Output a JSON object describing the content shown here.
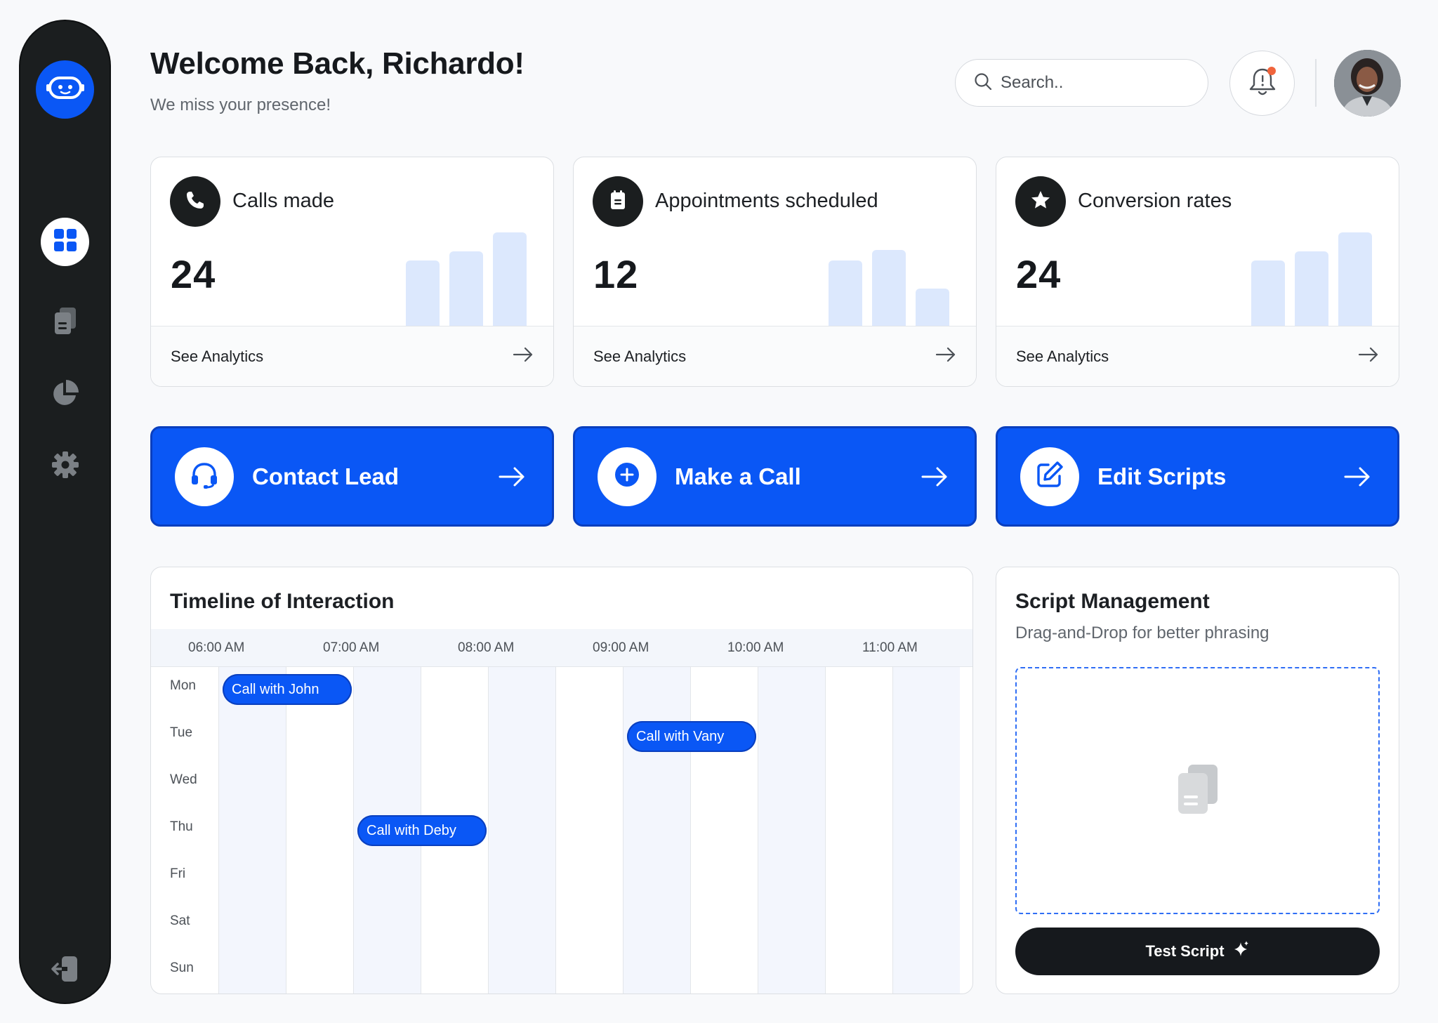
{
  "header": {
    "greeting": "Welcome Back, Richardo!",
    "subtitle": "We miss your presence!",
    "search_placeholder": "Search.."
  },
  "sidebar": {
    "items": [
      {
        "name": "dashboard",
        "icon": "grid-icon",
        "active": true
      },
      {
        "name": "documents",
        "icon": "document-icon",
        "active": false
      },
      {
        "name": "analytics",
        "icon": "pie-chart-icon",
        "active": false
      },
      {
        "name": "settings",
        "icon": "gear-icon",
        "active": false
      }
    ],
    "logout_icon": "logout-icon"
  },
  "stats": [
    {
      "label": "Calls made",
      "value": "24",
      "icon": "phone-icon",
      "footer": "See Analytics",
      "bars": [
        0.53,
        0.6,
        0.75
      ]
    },
    {
      "label": "Appointments scheduled",
      "value": "12",
      "icon": "notepad-icon",
      "footer": "See Analytics",
      "bars": [
        0.53,
        0.61,
        0.31
      ]
    },
    {
      "label": "Conversion rates",
      "value": "24",
      "icon": "star-icon",
      "footer": "See Analytics",
      "bars": [
        0.53,
        0.6,
        0.75
      ]
    }
  ],
  "actions": [
    {
      "label": "Contact Lead",
      "icon": "headset-icon"
    },
    {
      "label": "Make a Call",
      "icon": "plus-circle-icon"
    },
    {
      "label": "Edit Scripts",
      "icon": "edit-icon"
    }
  ],
  "timeline": {
    "title": "Timeline of Interaction",
    "hours": [
      "06:00 AM",
      "07:00 AM",
      "08:00 AM",
      "09:00 AM",
      "10:00 AM",
      "11:00 AM"
    ],
    "days": [
      "Mon",
      "Tue",
      "Wed",
      "Thu",
      "Fri",
      "Sat",
      "Sun"
    ],
    "events": [
      {
        "label": "Call with John",
        "day": "Mon",
        "start": "06:00 AM"
      },
      {
        "label": "Call with Vany",
        "day": "Tue",
        "start": "09:00 AM"
      },
      {
        "label": "Call with Deby",
        "day": "Thu",
        "start": "07:00 AM"
      }
    ]
  },
  "script_management": {
    "title": "Script Management",
    "subtitle": "Drag-and-Drop for better phrasing",
    "button_label": "Test Script"
  },
  "colors": {
    "accent": "#0a57f5",
    "sidebar": "#1b1e1f",
    "bar": "#dce8fd"
  }
}
